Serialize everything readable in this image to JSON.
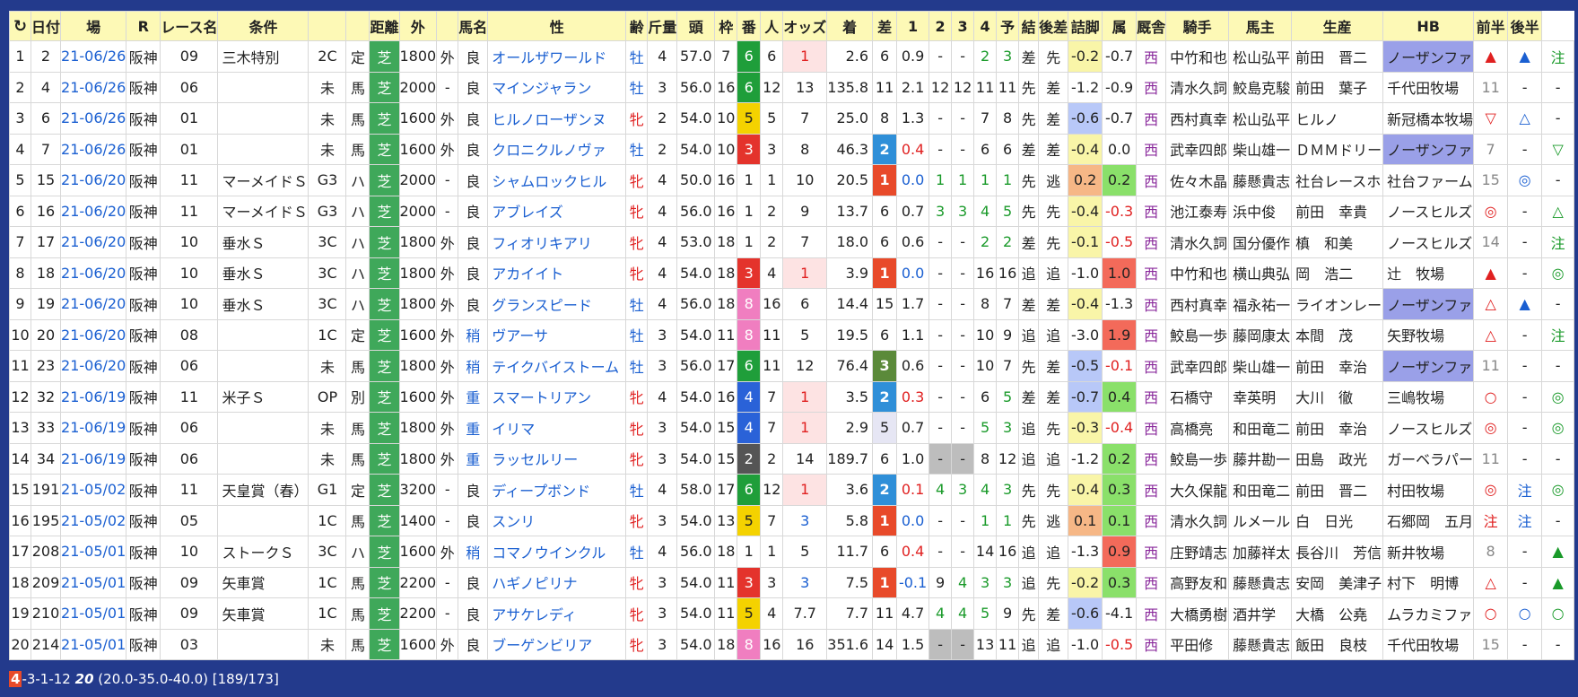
{
  "header": {
    "refresh_icon": "refresh-icon",
    "columns": [
      "",
      "日付",
      "場",
      "R",
      "レース名",
      "条件",
      "",
      "",
      "距離",
      "外",
      "",
      "馬名",
      "性",
      "齢",
      "斤量",
      "頭",
      "枠",
      "番",
      "人",
      "オッズ",
      "着",
      "差",
      "1",
      "2",
      "3",
      "4",
      "予",
      "結",
      "後差",
      "詰脚",
      "属",
      "厩舎",
      "騎手",
      "馬主",
      "生産",
      "HB",
      "前半",
      "後半"
    ]
  },
  "rows": [
    {
      "no": "1",
      "id": "2",
      "date": "21-06/26",
      "venue": "阪神",
      "r": "09",
      "race": "三木特別",
      "cond": "2C",
      "rule": "定",
      "surf": "芝",
      "dist": "1800",
      "out": "外",
      "going": "良",
      "horse": "オールザワールド",
      "sex": "牡",
      "age": "4",
      "wt": "57.0",
      "heads": "7",
      "waku": "6",
      "ban": "6",
      "pop": "1",
      "odds": "2.6",
      "rank": "6",
      "diff": "0.9",
      "p1": "-",
      "p2": "-",
      "p3": "2",
      "p4": "3",
      "pred": "差",
      "res": "先",
      "after": "-0.2",
      "tsume": "-0.7",
      "belong": "西",
      "stable": "中竹和也",
      "jockey": "松山弘平",
      "owner": "前田　晋二",
      "breeder": "ノーザンファ",
      "hb": "▲",
      "zen": "▲",
      "kou": "注"
    },
    {
      "no": "2",
      "id": "4",
      "date": "21-06/26",
      "venue": "阪神",
      "r": "06",
      "race": "",
      "cond": "未",
      "rule": "馬",
      "surf": "芝",
      "dist": "2000",
      "out": "-",
      "going": "良",
      "horse": "マインジャラン",
      "sex": "牡",
      "age": "3",
      "wt": "56.0",
      "heads": "16",
      "waku": "6",
      "ban": "12",
      "pop": "13",
      "odds": "135.8",
      "rank": "11",
      "diff": "2.1",
      "p1": "12",
      "p2": "12",
      "p3": "11",
      "p4": "11",
      "pred": "先",
      "res": "差",
      "after": "-1.2",
      "tsume": "-0.9",
      "belong": "西",
      "stable": "清水久詞",
      "jockey": "鮫島克駿",
      "owner": "前田　葉子",
      "breeder": "千代田牧場",
      "hb": "11",
      "zen": "-",
      "kou": "-"
    },
    {
      "no": "3",
      "id": "6",
      "date": "21-06/26",
      "venue": "阪神",
      "r": "01",
      "race": "",
      "cond": "未",
      "rule": "馬",
      "surf": "芝",
      "dist": "1600",
      "out": "外",
      "going": "良",
      "horse": "ヒルノローザンヌ",
      "sex": "牝",
      "age": "2",
      "wt": "54.0",
      "heads": "10",
      "waku": "5",
      "ban": "5",
      "pop": "7",
      "odds": "25.0",
      "rank": "8",
      "diff": "1.3",
      "p1": "-",
      "p2": "-",
      "p3": "7",
      "p4": "8",
      "pred": "先",
      "res": "差",
      "after": "-0.6",
      "tsume": "-0.7",
      "belong": "西",
      "stable": "西村真幸",
      "jockey": "松山弘平",
      "owner": "ヒルノ",
      "breeder": "新冠橋本牧場",
      "hb": "▽",
      "zen": "△",
      "kou": "-"
    },
    {
      "no": "4",
      "id": "7",
      "date": "21-06/26",
      "venue": "阪神",
      "r": "01",
      "race": "",
      "cond": "未",
      "rule": "馬",
      "surf": "芝",
      "dist": "1600",
      "out": "外",
      "going": "良",
      "horse": "クロニクルノヴァ",
      "sex": "牡",
      "age": "2",
      "wt": "54.0",
      "heads": "10",
      "waku": "3",
      "ban": "3",
      "pop": "8",
      "odds": "46.3",
      "rank": "2",
      "diff": "0.4",
      "p1": "-",
      "p2": "-",
      "p3": "6",
      "p4": "6",
      "pred": "差",
      "res": "差",
      "after": "-0.4",
      "tsume": "0.0",
      "belong": "西",
      "stable": "武幸四郎",
      "jockey": "柴山雄一",
      "owner": "ＤＭＭドリー",
      "breeder": "ノーザンファ",
      "hb": "7",
      "zen": "-",
      "kou": "▽"
    },
    {
      "no": "5",
      "id": "15",
      "date": "21-06/20",
      "venue": "阪神",
      "r": "11",
      "race": "マーメイドＳ",
      "cond": "G3",
      "rule": "ハ",
      "surf": "芝",
      "dist": "2000",
      "out": "-",
      "going": "良",
      "horse": "シャムロックヒル",
      "sex": "牝",
      "age": "4",
      "wt": "50.0",
      "heads": "16",
      "waku": "1",
      "ban": "1",
      "pop": "10",
      "odds": "20.5",
      "rank": "1",
      "diff": "0.0",
      "p1": "1",
      "p2": "1",
      "p3": "1",
      "p4": "1",
      "pred": "先",
      "res": "逃",
      "after": "0.2",
      "tsume": "0.2",
      "belong": "西",
      "stable": "佐々木晶",
      "jockey": "藤懸貴志",
      "owner": "社台レースホ",
      "breeder": "社台ファーム",
      "hb": "15",
      "zen": "◎",
      "kou": "-"
    },
    {
      "no": "6",
      "id": "16",
      "date": "21-06/20",
      "venue": "阪神",
      "r": "11",
      "race": "マーメイドＳ",
      "cond": "G3",
      "rule": "ハ",
      "surf": "芝",
      "dist": "2000",
      "out": "-",
      "going": "良",
      "horse": "アブレイズ",
      "sex": "牝",
      "age": "4",
      "wt": "56.0",
      "heads": "16",
      "waku": "1",
      "ban": "2",
      "pop": "9",
      "odds": "13.7",
      "rank": "6",
      "diff": "0.7",
      "p1": "3",
      "p2": "3",
      "p3": "4",
      "p4": "5",
      "pred": "先",
      "res": "先",
      "after": "-0.4",
      "tsume": "-0.3",
      "belong": "西",
      "stable": "池江泰寿",
      "jockey": "浜中俊",
      "owner": "前田　幸貴",
      "breeder": "ノースヒルズ",
      "hb": "◎",
      "zen": "-",
      "kou": "△"
    },
    {
      "no": "7",
      "id": "17",
      "date": "21-06/20",
      "venue": "阪神",
      "r": "10",
      "race": "垂水Ｓ",
      "cond": "3C",
      "rule": "ハ",
      "surf": "芝",
      "dist": "1800",
      "out": "外",
      "going": "良",
      "horse": "フィオリキアリ",
      "sex": "牝",
      "age": "4",
      "wt": "53.0",
      "heads": "18",
      "waku": "1",
      "ban": "2",
      "pop": "7",
      "odds": "18.0",
      "rank": "6",
      "diff": "0.6",
      "p1": "-",
      "p2": "-",
      "p3": "2",
      "p4": "2",
      "pred": "差",
      "res": "先",
      "after": "-0.1",
      "tsume": "-0.5",
      "belong": "西",
      "stable": "清水久詞",
      "jockey": "国分優作",
      "owner": "槙　和美",
      "breeder": "ノースヒルズ",
      "hb": "14",
      "zen": "-",
      "kou": "注"
    },
    {
      "no": "8",
      "id": "18",
      "date": "21-06/20",
      "venue": "阪神",
      "r": "10",
      "race": "垂水Ｓ",
      "cond": "3C",
      "rule": "ハ",
      "surf": "芝",
      "dist": "1800",
      "out": "外",
      "going": "良",
      "horse": "アカイイト",
      "sex": "牝",
      "age": "4",
      "wt": "54.0",
      "heads": "18",
      "waku": "3",
      "ban": "4",
      "pop": "1",
      "odds": "3.9",
      "rank": "1",
      "diff": "0.0",
      "p1": "-",
      "p2": "-",
      "p3": "16",
      "p4": "16",
      "pred": "追",
      "res": "追",
      "after": "-1.0",
      "tsume": "1.0",
      "belong": "西",
      "stable": "中竹和也",
      "jockey": "横山典弘",
      "owner": "岡　浩二",
      "breeder": "辻　牧場",
      "hb": "▲",
      "zen": "-",
      "kou": "◎"
    },
    {
      "no": "9",
      "id": "19",
      "date": "21-06/20",
      "venue": "阪神",
      "r": "10",
      "race": "垂水Ｓ",
      "cond": "3C",
      "rule": "ハ",
      "surf": "芝",
      "dist": "1800",
      "out": "外",
      "going": "良",
      "horse": "グランスピード",
      "sex": "牡",
      "age": "4",
      "wt": "56.0",
      "heads": "18",
      "waku": "8",
      "ban": "16",
      "pop": "6",
      "odds": "14.4",
      "rank": "15",
      "diff": "1.7",
      "p1": "-",
      "p2": "-",
      "p3": "8",
      "p4": "7",
      "pred": "差",
      "res": "差",
      "after": "-0.4",
      "tsume": "-1.3",
      "belong": "西",
      "stable": "西村真幸",
      "jockey": "福永祐一",
      "owner": "ライオンレー",
      "breeder": "ノーザンファ",
      "hb": "△",
      "zen": "▲",
      "kou": "-"
    },
    {
      "no": "10",
      "id": "20",
      "date": "21-06/20",
      "venue": "阪神",
      "r": "08",
      "race": "",
      "cond": "1C",
      "rule": "定",
      "surf": "芝",
      "dist": "1600",
      "out": "外",
      "going": "稍",
      "horse": "ヴアーサ",
      "sex": "牡",
      "age": "3",
      "wt": "54.0",
      "heads": "11",
      "waku": "8",
      "ban": "11",
      "pop": "5",
      "odds": "19.5",
      "rank": "6",
      "diff": "1.1",
      "p1": "-",
      "p2": "-",
      "p3": "10",
      "p4": "9",
      "pred": "追",
      "res": "追",
      "after": "-3.0",
      "tsume": "1.9",
      "belong": "西",
      "stable": "鮫島一歩",
      "jockey": "藤岡康太",
      "owner": "本間　茂",
      "breeder": "矢野牧場",
      "hb": "△",
      "zen": "-",
      "kou": "注"
    },
    {
      "no": "11",
      "id": "23",
      "date": "21-06/20",
      "venue": "阪神",
      "r": "06",
      "race": "",
      "cond": "未",
      "rule": "馬",
      "surf": "芝",
      "dist": "1800",
      "out": "外",
      "going": "稍",
      "horse": "テイクバイストーム",
      "sex": "牡",
      "age": "3",
      "wt": "56.0",
      "heads": "17",
      "waku": "6",
      "ban": "11",
      "pop": "12",
      "odds": "76.4",
      "rank": "3",
      "diff": "0.6",
      "p1": "-",
      "p2": "-",
      "p3": "10",
      "p4": "7",
      "pred": "先",
      "res": "差",
      "after": "-0.5",
      "tsume": "-0.1",
      "belong": "西",
      "stable": "武幸四郎",
      "jockey": "柴山雄一",
      "owner": "前田　幸治",
      "breeder": "ノーザンファ",
      "hb": "11",
      "zen": "-",
      "kou": "-"
    },
    {
      "no": "12",
      "id": "32",
      "date": "21-06/19",
      "venue": "阪神",
      "r": "11",
      "race": "米子Ｓ",
      "cond": "OP",
      "rule": "別",
      "surf": "芝",
      "dist": "1600",
      "out": "外",
      "going": "重",
      "horse": "スマートリアン",
      "sex": "牝",
      "age": "4",
      "wt": "54.0",
      "heads": "16",
      "waku": "4",
      "ban": "7",
      "pop": "1",
      "odds": "3.5",
      "rank": "2",
      "diff": "0.3",
      "p1": "-",
      "p2": "-",
      "p3": "6",
      "p4": "5",
      "pred": "差",
      "res": "差",
      "after": "-0.7",
      "tsume": "0.4",
      "belong": "西",
      "stable": "石橋守",
      "jockey": "幸英明",
      "owner": "大川　徹",
      "breeder": "三嶋牧場",
      "hb": "○",
      "zen": "-",
      "kou": "◎"
    },
    {
      "no": "13",
      "id": "33",
      "date": "21-06/19",
      "venue": "阪神",
      "r": "06",
      "race": "",
      "cond": "未",
      "rule": "馬",
      "surf": "芝",
      "dist": "1800",
      "out": "外",
      "going": "重",
      "horse": "イリマ",
      "sex": "牝",
      "age": "3",
      "wt": "54.0",
      "heads": "15",
      "waku": "4",
      "ban": "7",
      "pop": "1",
      "odds": "2.9",
      "rank": "5",
      "diff": "0.7",
      "p1": "-",
      "p2": "-",
      "p3": "5",
      "p4": "3",
      "pred": "追",
      "res": "先",
      "after": "-0.3",
      "tsume": "-0.4",
      "belong": "西",
      "stable": "高橋亮",
      "jockey": "和田竜二",
      "owner": "前田　幸治",
      "breeder": "ノースヒルズ",
      "hb": "◎",
      "zen": "-",
      "kou": "◎"
    },
    {
      "no": "14",
      "id": "34",
      "date": "21-06/19",
      "venue": "阪神",
      "r": "06",
      "race": "",
      "cond": "未",
      "rule": "馬",
      "surf": "芝",
      "dist": "1800",
      "out": "外",
      "going": "重",
      "horse": "ラッセルリー",
      "sex": "牝",
      "age": "3",
      "wt": "54.0",
      "heads": "15",
      "waku": "2",
      "ban": "2",
      "pop": "14",
      "odds": "189.7",
      "rank": "6",
      "diff": "1.0",
      "p1": "-",
      "p2": "-",
      "p3": "8",
      "p4": "12",
      "pred": "追",
      "res": "追",
      "after": "-1.2",
      "tsume": "0.2",
      "belong": "西",
      "stable": "鮫島一歩",
      "jockey": "藤井勘一",
      "owner": "田島　政光",
      "breeder": "ガーベラパー",
      "hb": "11",
      "zen": "-",
      "kou": "-"
    },
    {
      "no": "15",
      "id": "191",
      "date": "21-05/02",
      "venue": "阪神",
      "r": "11",
      "race": "天皇賞（春）",
      "cond": "G1",
      "rule": "定",
      "surf": "芝",
      "dist": "3200",
      "out": "-",
      "going": "良",
      "horse": "ディープボンド",
      "sex": "牡",
      "age": "4",
      "wt": "58.0",
      "heads": "17",
      "waku": "6",
      "ban": "12",
      "pop": "1",
      "odds": "3.6",
      "rank": "2",
      "diff": "0.1",
      "p1": "4",
      "p2": "3",
      "p3": "4",
      "p4": "3",
      "pred": "先",
      "res": "先",
      "after": "-0.4",
      "tsume": "0.3",
      "belong": "西",
      "stable": "大久保龍",
      "jockey": "和田竜二",
      "owner": "前田　晋二",
      "breeder": "村田牧場",
      "hb": "◎",
      "zen": "注",
      "kou": "◎"
    },
    {
      "no": "16",
      "id": "195",
      "date": "21-05/02",
      "venue": "阪神",
      "r": "05",
      "race": "",
      "cond": "1C",
      "rule": "馬",
      "surf": "芝",
      "dist": "1400",
      "out": "-",
      "going": "良",
      "horse": "スンリ",
      "sex": "牝",
      "age": "3",
      "wt": "54.0",
      "heads": "13",
      "waku": "5",
      "ban": "7",
      "pop": "3",
      "odds": "5.8",
      "rank": "1",
      "diff": "0.0",
      "p1": "-",
      "p2": "-",
      "p3": "1",
      "p4": "1",
      "pred": "先",
      "res": "逃",
      "after": "0.1",
      "tsume": "0.1",
      "belong": "西",
      "stable": "清水久詞",
      "jockey": "ルメール",
      "owner": "白　日光",
      "breeder": "石郷岡　五月",
      "hb": "注",
      "zen": "注",
      "kou": "-"
    },
    {
      "no": "17",
      "id": "208",
      "date": "21-05/01",
      "venue": "阪神",
      "r": "10",
      "race": "ストークＳ",
      "cond": "3C",
      "rule": "ハ",
      "surf": "芝",
      "dist": "1600",
      "out": "外",
      "going": "稍",
      "horse": "コマノウインクル",
      "sex": "牡",
      "age": "4",
      "wt": "56.0",
      "heads": "18",
      "waku": "1",
      "ban": "1",
      "pop": "5",
      "odds": "11.7",
      "rank": "6",
      "diff": "0.4",
      "p1": "-",
      "p2": "-",
      "p3": "14",
      "p4": "16",
      "pred": "追",
      "res": "追",
      "after": "-1.3",
      "tsume": "0.9",
      "belong": "西",
      "stable": "庄野靖志",
      "jockey": "加藤祥太",
      "owner": "長谷川　芳信",
      "breeder": "新井牧場",
      "hb": "8",
      "zen": "-",
      "kou": "▲"
    },
    {
      "no": "18",
      "id": "209",
      "date": "21-05/01",
      "venue": "阪神",
      "r": "09",
      "race": "矢車賞",
      "cond": "1C",
      "rule": "馬",
      "surf": "芝",
      "dist": "2200",
      "out": "-",
      "going": "良",
      "horse": "ハギノピリナ",
      "sex": "牝",
      "age": "3",
      "wt": "54.0",
      "heads": "11",
      "waku": "3",
      "ban": "3",
      "pop": "3",
      "odds": "7.5",
      "rank": "1",
      "diff": "-0.1",
      "p1": "9",
      "p2": "4",
      "p3": "3",
      "p4": "3",
      "pred": "追",
      "res": "先",
      "after": "-0.2",
      "tsume": "0.3",
      "belong": "西",
      "stable": "高野友和",
      "jockey": "藤懸貴志",
      "owner": "安岡　美津子",
      "breeder": "村下　明博",
      "hb": "△",
      "zen": "-",
      "kou": "▲"
    },
    {
      "no": "19",
      "id": "210",
      "date": "21-05/01",
      "venue": "阪神",
      "r": "09",
      "race": "矢車賞",
      "cond": "1C",
      "rule": "馬",
      "surf": "芝",
      "dist": "2200",
      "out": "-",
      "going": "良",
      "horse": "アサケレディ",
      "sex": "牝",
      "age": "3",
      "wt": "54.0",
      "heads": "11",
      "waku": "5",
      "ban": "4",
      "pop": "7.7",
      "odds": "7.7",
      "rank": "11",
      "diff": "4.7",
      "p1": "4",
      "p2": "4",
      "p3": "5",
      "p4": "9",
      "pred": "先",
      "res": "差",
      "after": "-0.6",
      "tsume": "-4.1",
      "belong": "西",
      "stable": "大橋勇樹",
      "jockey": "酒井学",
      "owner": "大橋　公堯",
      "breeder": "ムラカミファ",
      "hb": "○",
      "zen": "○",
      "kou": "○"
    },
    {
      "no": "20",
      "id": "214",
      "date": "21-05/01",
      "venue": "阪神",
      "r": "03",
      "race": "",
      "cond": "未",
      "rule": "馬",
      "surf": "芝",
      "dist": "1600",
      "out": "外",
      "going": "良",
      "horse": "ブーゲンビリア",
      "sex": "牝",
      "age": "3",
      "wt": "54.0",
      "heads": "18",
      "waku": "8",
      "ban": "16",
      "pop": "16",
      "odds": "351.6",
      "rank": "14",
      "diff": "1.5",
      "p1": "-",
      "p2": "-",
      "p3": "13",
      "p4": "11",
      "pred": "追",
      "res": "追",
      "after": "-1.0",
      "tsume": "-0.5",
      "belong": "西",
      "stable": "平田修",
      "jockey": "藤懸貴志",
      "owner": "飯田　良枝",
      "breeder": "千代田牧場",
      "hb": "15",
      "zen": "-",
      "kou": "-"
    }
  ],
  "footer": {
    "a": "4",
    "rest": "-3-1-12",
    "b": "20",
    "stats": "(20.0-35.0-40.0) [189/173]"
  },
  "colors": {
    "background": "#233a8c",
    "header_bg": "#fdf9b6",
    "turf": "#3fa85a",
    "win": "#e84a2a",
    "place2": "#2f8fd8"
  }
}
